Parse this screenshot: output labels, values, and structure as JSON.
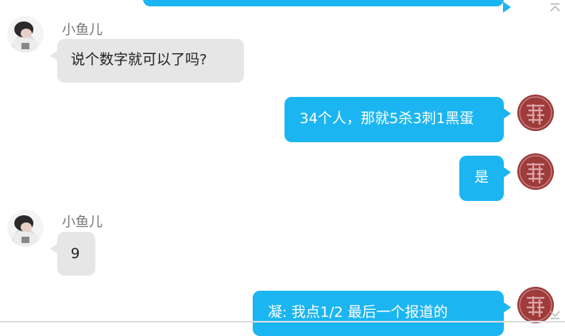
{
  "colors": {
    "outgoing": "#1bb5f1",
    "incoming": "#e6e6e6"
  },
  "messages": [
    {
      "sender": "小鱼儿",
      "text": "说个数字就可以了吗?"
    },
    {
      "text": "34个人，那就5杀3刺1黑蛋"
    },
    {
      "text": "是"
    },
    {
      "sender": "小鱼儿",
      "text": "9"
    },
    {
      "text": "凝:  我点1/2  最后一个报道的"
    }
  ],
  "icons": {
    "scroll_up": "chevron-up-icon",
    "scroll_down": "chevron-down-icon"
  }
}
